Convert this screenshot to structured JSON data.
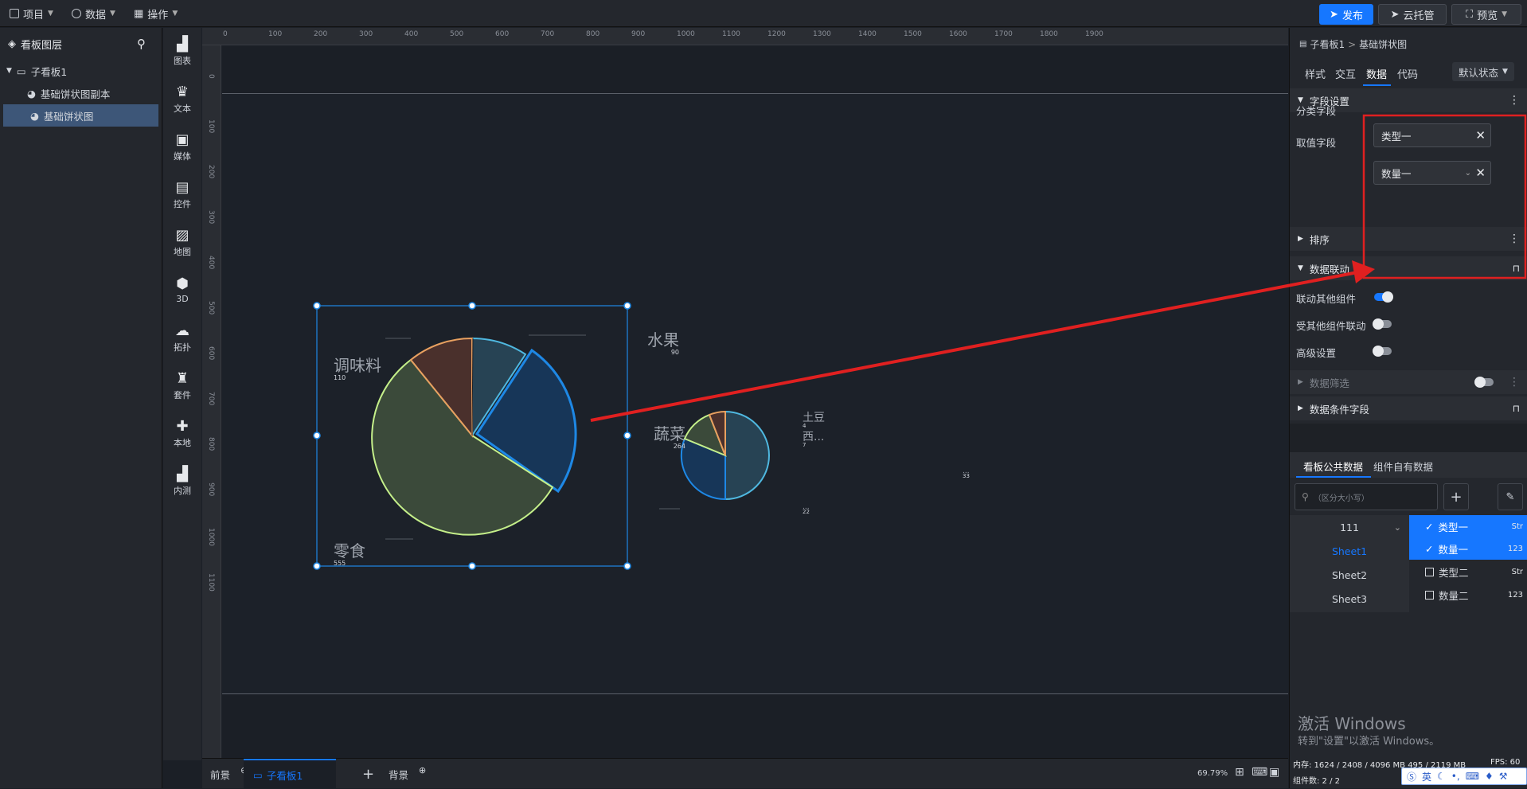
{
  "menu": {
    "project": "项目",
    "data": "数据",
    "operate": "操作"
  },
  "actions": {
    "publish": "发布",
    "cloud": "云托管",
    "preview": "预览"
  },
  "layers": {
    "title": "看板图层",
    "board": "子看板1",
    "items": [
      {
        "label": "基础饼状图副本"
      },
      {
        "label": "基础饼状图"
      }
    ]
  },
  "tools": [
    "图表",
    "文本",
    "媒体",
    "控件",
    "地图",
    "3D",
    "拓扑",
    "套件",
    "本地",
    "内测"
  ],
  "ruler": {
    "h": [
      "0",
      "100",
      "200",
      "300",
      "400",
      "500",
      "600",
      "700",
      "800",
      "900",
      "1000",
      "1100",
      "1200",
      "1300",
      "1400",
      "1500",
      "1600",
      "1700",
      "1800",
      "1900"
    ],
    "v": [
      "0",
      "100",
      "200",
      "300",
      "400",
      "500",
      "600",
      "700",
      "800",
      "900",
      "1000",
      "1100"
    ]
  },
  "chart_main": {
    "labels": [
      {
        "name": "调味料",
        "value": "110"
      },
      {
        "name": "水果",
        "value": "90"
      },
      {
        "name": "蔬菜",
        "value": "264"
      },
      {
        "name": "零食",
        "value": "555"
      }
    ]
  },
  "chart_small": {
    "labels": [
      {
        "name": "土豆",
        "value": "4"
      },
      {
        "name": "西...",
        "value": "7"
      },
      {
        "name": "...",
        "value": "33"
      },
      {
        "name": "...",
        "value": "22"
      }
    ]
  },
  "breadcrumb": {
    "board": "子看板1",
    "sep": ">",
    "item": "基础饼状图"
  },
  "rtabs": {
    "style": "样式",
    "interact": "交互",
    "data": "数据",
    "code": "代码",
    "state": "默认状态"
  },
  "field_settings": {
    "title": "字段设置",
    "category_label": "分类字段",
    "category_value": "类型一",
    "value_label": "取值字段",
    "value_value": "数量一"
  },
  "sort_title": "排序",
  "linkage": {
    "title": "数据联动",
    "link_others": "联动其他组件",
    "linked_by": "受其他组件联动",
    "advanced": "高级设置"
  },
  "filter_title": "数据筛选",
  "cond_title": "数据条件字段",
  "source_tabs": {
    "public": "看板公共数据",
    "own": "组件自有数据"
  },
  "search_placeholder": "（区分大小写）",
  "dataset": "111",
  "sheets": [
    "Sheet1",
    "Sheet2",
    "Sheet3"
  ],
  "fields": [
    {
      "name": "类型一",
      "type": "Str",
      "checked": true
    },
    {
      "name": "数量一",
      "type": "123",
      "checked": true
    },
    {
      "name": "类型二",
      "type": "Str",
      "checked": false
    },
    {
      "name": "数量二",
      "type": "123",
      "checked": false
    }
  ],
  "watermark": {
    "title": "激活 Windows",
    "sub": "转到\"设置\"以激活 Windows。"
  },
  "bottom": {
    "front": "前景",
    "board": "子看板1",
    "back": "背景",
    "zoom": "69.79%"
  },
  "status": {
    "memory": "内存:  1624 / 2408 / 4096 MB  495 / 2119 MB",
    "fps": "FPS: 60",
    "count": "组件数: 2 / 2"
  },
  "ime": {
    "lang": "英"
  },
  "colors": {
    "accent": "#1677ff",
    "annotation": "#e02020"
  }
}
